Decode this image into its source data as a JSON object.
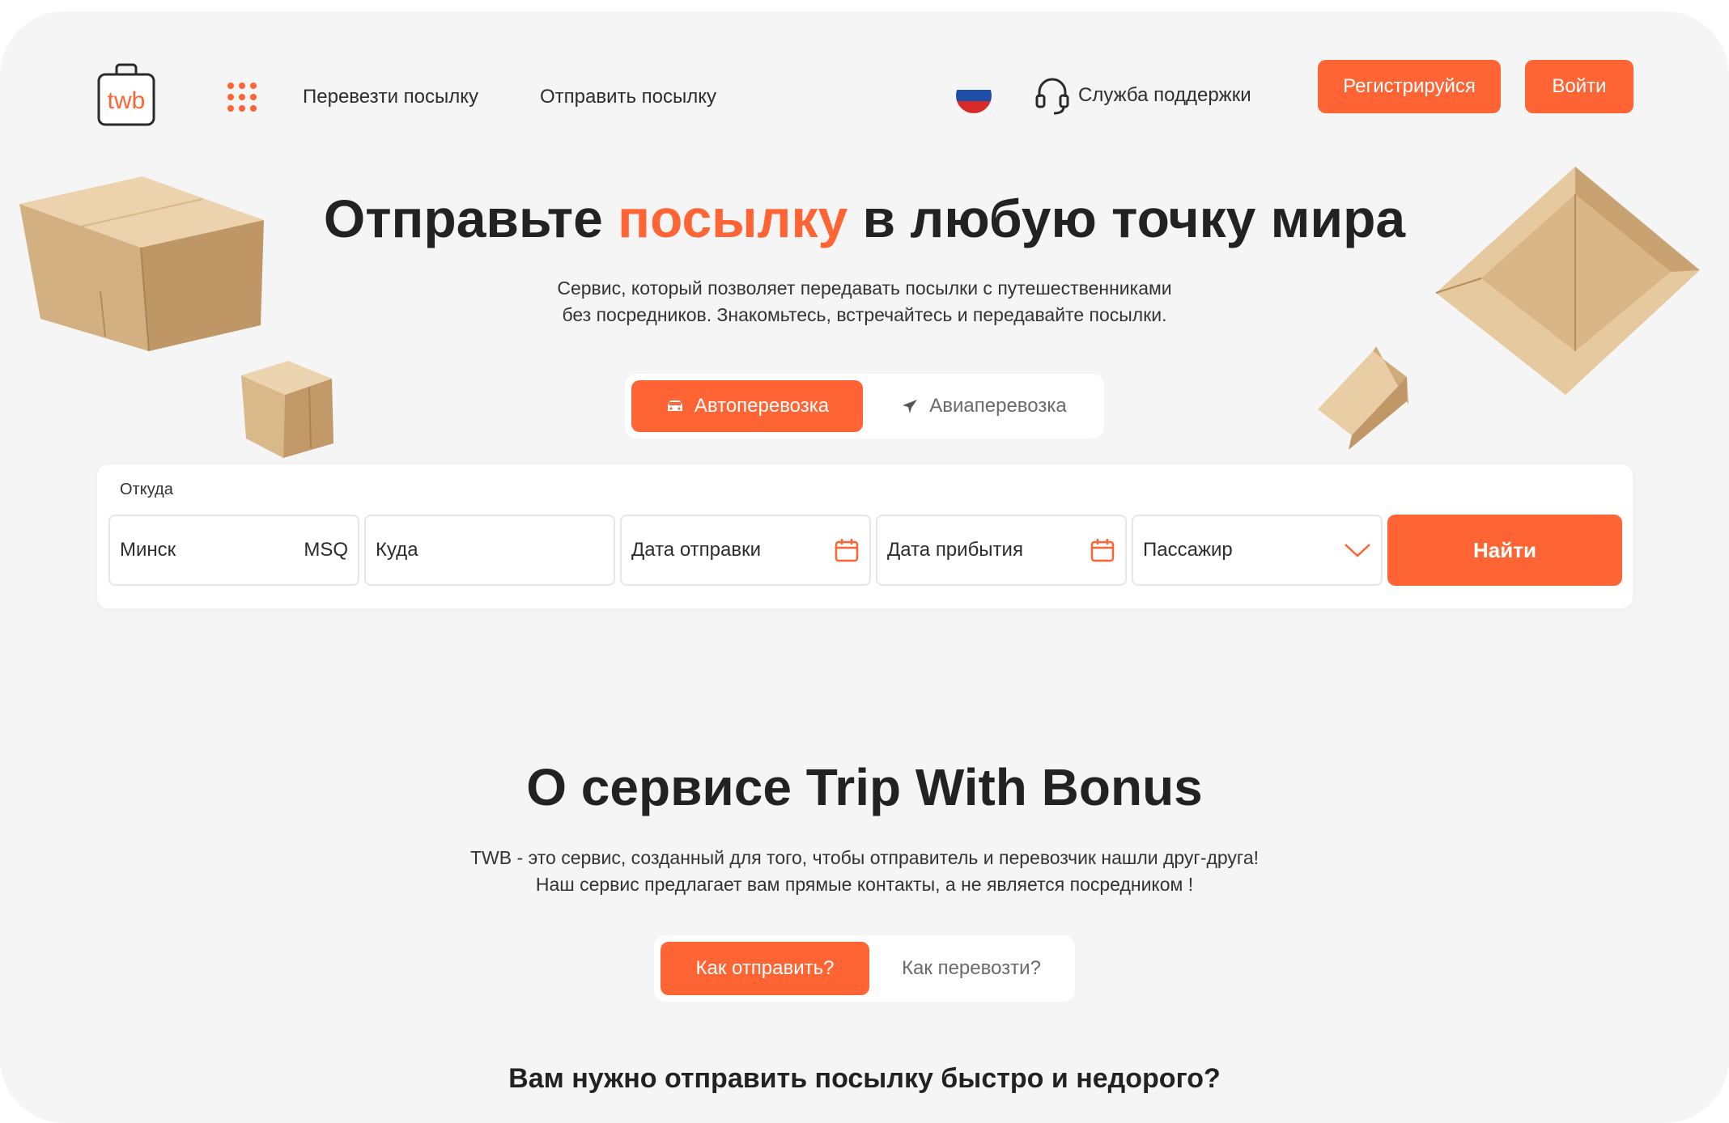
{
  "header": {
    "logo_text": "twb",
    "nav": [
      "Перевезти посылку",
      "Отправить посылку"
    ],
    "support_label": "Служба поддержки",
    "register_label": "Регистрируйся",
    "login_label": "Войти"
  },
  "hero": {
    "title_before": "Отправьте ",
    "title_accent": "посылку",
    "title_after": " в любую точку мира",
    "subtitle_line1": "Сервис, который позволяет передавать посылки с путешественниками",
    "subtitle_line2": "без посредников. Знакомьтесь, встречайтесь и передавайте посылки.",
    "modes": [
      {
        "label": "Автоперевозка",
        "icon": "car-icon",
        "active": true
      },
      {
        "label": "Авиаперевозка",
        "icon": "airplane-icon",
        "active": false
      }
    ]
  },
  "search": {
    "from_label": "Откуда",
    "from_value": "Минск",
    "from_code": "MSQ",
    "to_placeholder": "Куда",
    "departure_placeholder": "Дата отправки",
    "arrival_placeholder": "Дата прибытия",
    "passenger_placeholder": "Пассажир",
    "search_button": "Найти"
  },
  "about": {
    "title": "О сервисе Trip With Bonus",
    "text_line1": "TWB  - это сервис, созданный для того, чтобы отправитель и перевозчик нашли друг-друга!",
    "text_line2": "Наш сервис предлагает вам прямые контакты, а не является посредником !",
    "tabs": [
      "Как отправить?",
      "Как перевозти?"
    ],
    "question": "Вам нужно отправить посылку быстро и недорого?"
  },
  "colors": {
    "accent": "#ff6534",
    "background": "#f5f5f5",
    "text": "#222222"
  }
}
